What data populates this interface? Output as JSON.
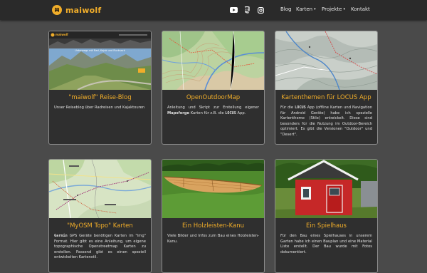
{
  "brand": {
    "name": "maiwolf"
  },
  "nav": {
    "social": [
      "youtube-icon",
      "mastodon-icon",
      "instagram-icon"
    ],
    "links": [
      {
        "label": "Blog"
      },
      {
        "label": "Karten",
        "caret": "▾"
      },
      {
        "label": "Projekte",
        "caret": "▾"
      },
      {
        "label": "Kontakt"
      }
    ]
  },
  "cards": [
    {
      "title": "\"maiwolf\" Reise-Blog",
      "text": "Unser Reiseblog über Radreisen und Kajaktouren",
      "thumb": {
        "site_name": "maiwolf",
        "banner_text": "Unterwegs mit Rad, Kajak und Rucksack"
      }
    },
    {
      "title": "OpenOutdoorMap",
      "text_a": "Anleitung und Skript zur Erstellung eigener ",
      "text_b": "Mapsforge",
      "text_c": " Karten für z.B. die ",
      "text_d": "LOCUS",
      "text_e": " App."
    },
    {
      "title": "Kartenthemen für LOCUS App",
      "text_a": "Für die ",
      "text_b": "LOCUS",
      "text_c": " App (offline Karten und Navigation für Android Geräte) habe ich spezielle Kartentheme (Stile) entwickelt. Diese sind besonders für die Nutzung im Outdoor-Bereich optimiert. Es gibt die Versionen \"Outdoor\" und \"Desert\"."
    },
    {
      "title": "\"MyOSM Topo\" Karten",
      "text_a": "Garmin",
      "text_b": " GPS Geräte benötigen Karten im \"img\" Format. Hier gibt es eine Anleitung, um eigene topographische Openstreetmap Karten zu erstellen. Passend gibt es einen speziell entwickelten Kartenstil."
    },
    {
      "title": "Ein Holzleisten-Kanu",
      "text": "Viele Bilder und Infos zum Bau eines Holzleisten-Kanu."
    },
    {
      "title": "Ein Spielhaus",
      "text": "Für den Bau eines Spielhauses in unserem Garten habe ich einen Bauplan und eine Material Liste erstellt. Der Bau wurde mit Fotos dokumentiert."
    }
  ],
  "colors": {
    "accent": "#f0ad2a",
    "page_bg": "#4a4a4a",
    "card_bg": "#2f2f2f",
    "navbar_bg": "#2a2a2a"
  }
}
